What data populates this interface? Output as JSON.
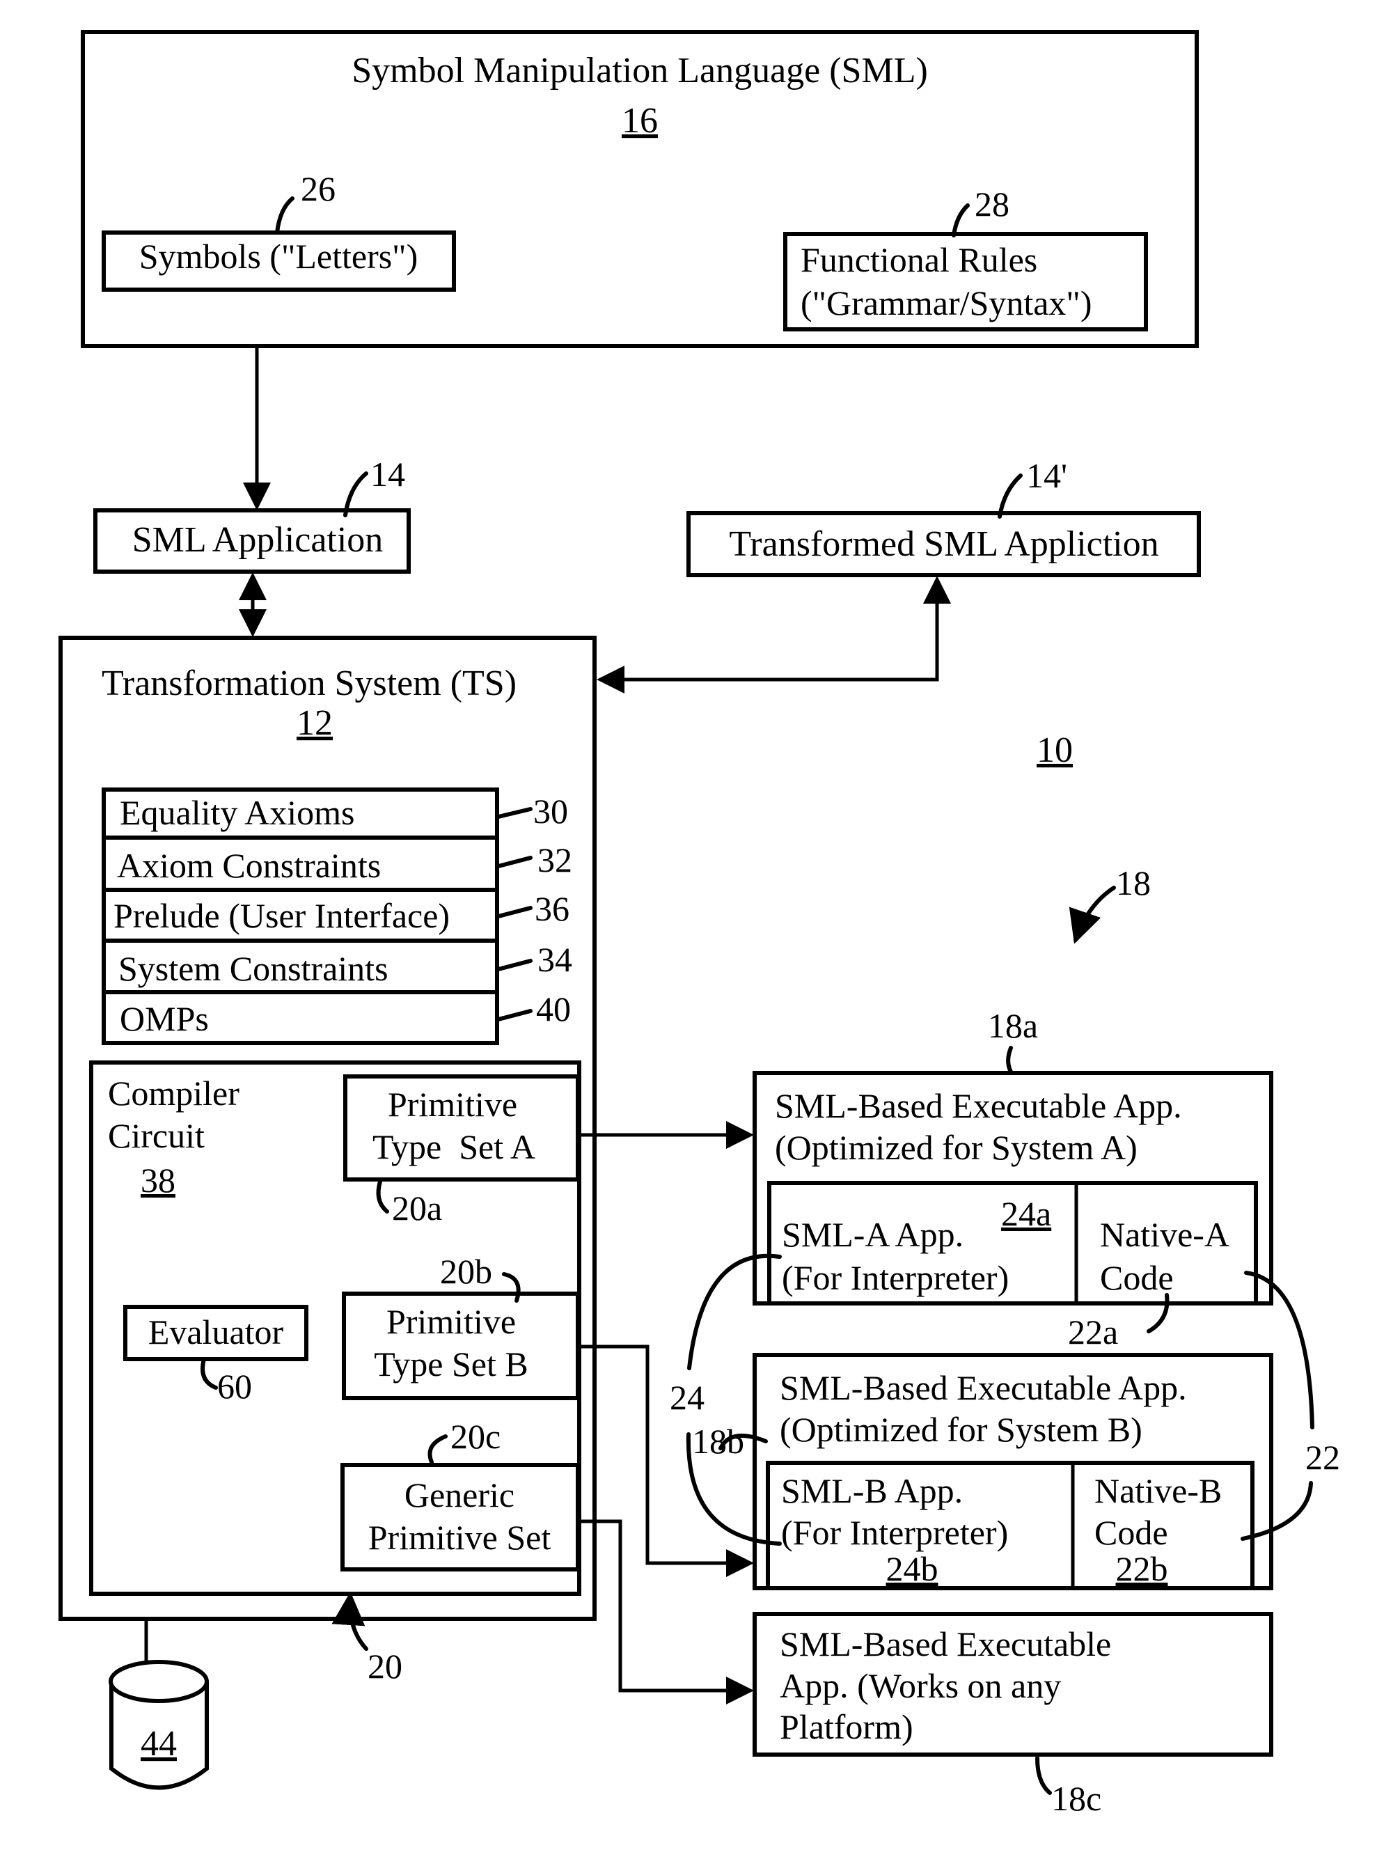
{
  "figure": {
    "system_ref": "10",
    "sml": {
      "title": "Symbol Manipulation Language (SML)",
      "ref": "16",
      "symbols": {
        "label": "Symbols (\"Letters\")",
        "ref": "26"
      },
      "functional_rules": {
        "line1": "Functional Rules",
        "line2": "(\"Grammar/Syntax\")",
        "ref": "28"
      }
    },
    "sml_application": {
      "label": "SML Application",
      "ref": "14"
    },
    "transformed_application": {
      "label": "Transformed SML Appliction",
      "ref": "14'"
    },
    "transformation_system": {
      "title": "Transformation System (TS)",
      "ref": "12",
      "components": [
        {
          "label": "Equality Axioms",
          "ref": "30"
        },
        {
          "label": "Axiom Constraints",
          "ref": "32"
        },
        {
          "label": "Prelude (User Interface)",
          "ref": "36"
        },
        {
          "label": "System Constraints",
          "ref": "34"
        },
        {
          "label": "OMPs",
          "ref": "40"
        }
      ],
      "compiler": {
        "line1": "Compiler",
        "line2": "Circuit",
        "ref": "38",
        "group_ref": "20",
        "evaluator": {
          "label": "Evaluator",
          "ref": "60"
        },
        "primitive_sets": [
          {
            "line1": "Primitive",
            "line2": "Type  Set A",
            "ref": "20a"
          },
          {
            "line1": "Primitive",
            "line2": "Type Set B",
            "ref": "20b"
          },
          {
            "line1": "Generic",
            "line2": "Primitive Set",
            "ref": "20c"
          }
        ]
      },
      "database": {
        "ref": "44"
      }
    },
    "executables": {
      "group_ref": "18",
      "app_a": {
        "ref": "18a",
        "line1": "SML-Based Executable App.",
        "line2": "(Optimized for System A)",
        "sml_part": {
          "line1": "SML-A App.",
          "line2": "(For Interpreter)",
          "ref": "24a"
        },
        "native_part": {
          "line1": "Native-A",
          "line2": "Code",
          "ref": "22a"
        }
      },
      "app_b": {
        "ref": "18b",
        "line1": "SML-Based Executable App.",
        "line2": "(Optimized for System B)",
        "sml_part": {
          "line1": "SML-B App.",
          "line2": "(For Interpreter)",
          "ref": "24b"
        },
        "native_part": {
          "line1": "Native-B",
          "line2": "Code",
          "ref": "22b"
        }
      },
      "app_c": {
        "ref": "18c",
        "line1": "SML-Based Executable",
        "line2": "App. (Works on any",
        "line3": "Platform)"
      },
      "sml_parts_ref": "24",
      "native_parts_ref": "22"
    }
  }
}
